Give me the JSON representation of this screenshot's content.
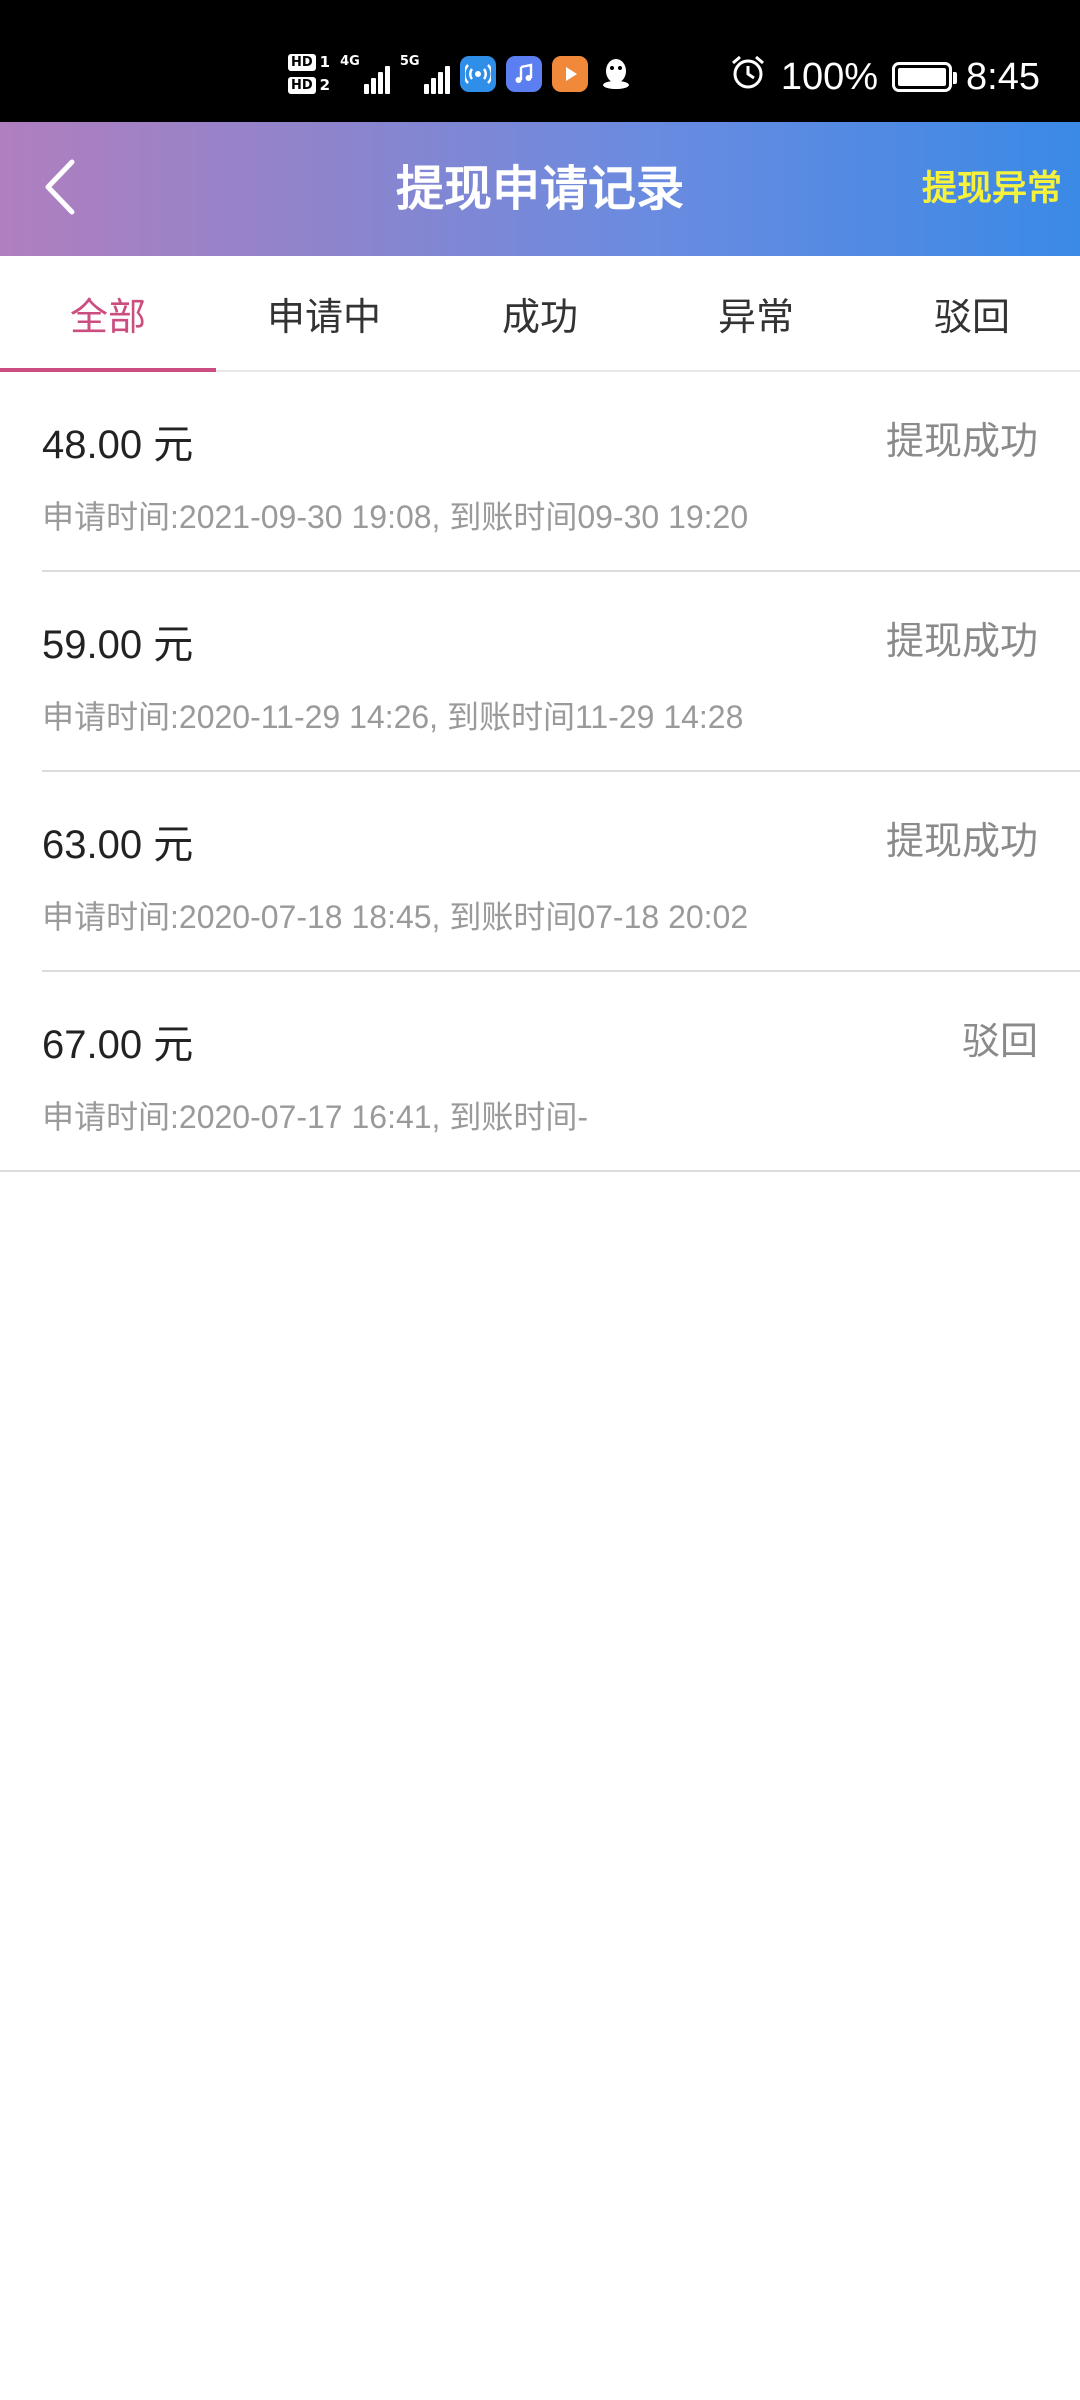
{
  "status_bar": {
    "hd1": "HD",
    "hd1_num": "1",
    "hd2": "HD",
    "hd2_num": "2",
    "net1": "4G",
    "net2": "5G",
    "battery_pct": "100%",
    "time": "8:45",
    "icons": [
      "wifi-hotspot-icon",
      "music-app-icon",
      "video-app-icon",
      "qq-icon",
      "alarm-icon",
      "battery-icon"
    ]
  },
  "header": {
    "title": "提现申请记录",
    "action": "提现异常",
    "back_icon": "chevron-left-icon"
  },
  "tabs": [
    {
      "label": "全部",
      "active": true
    },
    {
      "label": "申请中",
      "active": false
    },
    {
      "label": "成功",
      "active": false
    },
    {
      "label": "异常",
      "active": false
    },
    {
      "label": "驳回",
      "active": false
    }
  ],
  "records": [
    {
      "amount": "48.00 元",
      "status": "提现成功",
      "meta": "申请时间:2021-09-30 19:08, 到账时间09-30 19:20"
    },
    {
      "amount": "59.00 元",
      "status": "提现成功",
      "meta": "申请时间:2020-11-29 14:26, 到账时间11-29 14:28"
    },
    {
      "amount": "63.00 元",
      "status": "提现成功",
      "meta": "申请时间:2020-07-18 18:45, 到账时间07-18 20:02"
    },
    {
      "amount": "67.00 元",
      "status": "驳回",
      "meta": "申请时间:2020-07-17 16:41, 到账时间-"
    }
  ],
  "colors": {
    "accent": "#cc4d7f",
    "header_action": "#f6f13a"
  }
}
